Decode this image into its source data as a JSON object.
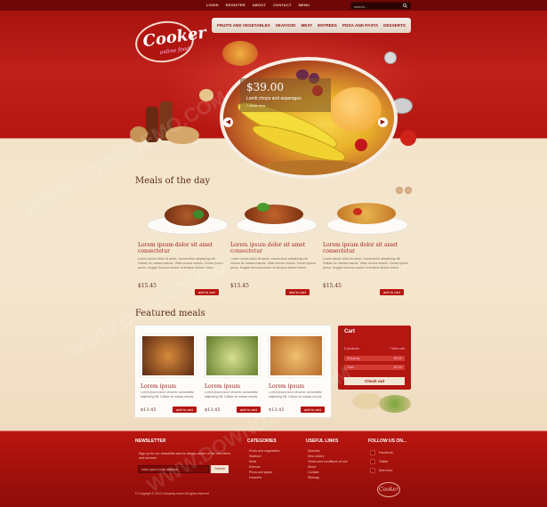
{
  "topbar": {
    "links": [
      "LOGIN",
      "REGISTER",
      "ABOUT",
      "CONTACT",
      "MENU"
    ],
    "search_placeholder": "search..."
  },
  "logo": {
    "name": "Cooker",
    "tagline": "online food"
  },
  "nav": {
    "items": [
      "FRUITS AND VEGETABLES",
      "SEAFOOD",
      "MEAT",
      "ENTREES",
      "PIZZA AND PASTA",
      "DESSERTS"
    ]
  },
  "hero": {
    "price": "$39.00",
    "description": "Lamb chops and asparagus",
    "link": "+ show now"
  },
  "meals_of_day": {
    "title": "Meals of the day",
    "items": [
      {
        "title": "Lorem ipsum dolor sit amet consectetur",
        "desc": "Lorem ipsum dolor sit amet, consectetur adipiscing elit. Nullam ac massa mauris. Vitae viverra mauris. Donec ipsum purus, feugiat rhoncus auctor ut tempus dictum lorem.",
        "price": "$15.45",
        "button": "add to cart"
      },
      {
        "title": "Lorem ipsum dolor sit amet consectetur",
        "desc": "Lorem ipsum dolor sit amet, consectetur adipiscing elit. Nullam ac massa mauris. Vitae viverra mauris. Donec ipsum purus, feugiat rhoncus auctor ut tempus dictum lorem.",
        "price": "$15.45",
        "button": "add to cart"
      },
      {
        "title": "Lorem ipsum dolor sit amet consectetur",
        "desc": "Lorem ipsum dolor sit amet, consectetur adipiscing elit. Nullam ac massa mauris. Vitae viverra mauris. Donec ipsum purus, feugiat rhoncus auctor ut tempus dictum lorem.",
        "price": "$15.45",
        "button": "add to cart"
      }
    ]
  },
  "featured": {
    "title": "Featured meals",
    "items": [
      {
        "title": "Lorem ipsum",
        "desc": "Lorem ipsum dolor sit amet, consectetur adipiscing elit. Nullam ac massa mauris.",
        "price": "$13.45",
        "button": "add to cart"
      },
      {
        "title": "Lorem ipsum",
        "desc": "Lorem ipsum dolor sit amet, consectetur adipiscing elit. Nullam ac massa mauris.",
        "price": "$13.45",
        "button": "add to cart"
      },
      {
        "title": "Lorem ipsum",
        "desc": "Lorem ipsum dolor sit amet, consectetur adipiscing elit. Nullam ac massa mauris.",
        "price": "$13.45",
        "button": "add to cart"
      }
    ]
  },
  "cart": {
    "title": "Cart",
    "products_label": "0 products",
    "view_cart": "+ View cart",
    "shipping_label": "Shipping",
    "shipping_value": "$0.00",
    "total_label": "Total",
    "total_value": "$0.00",
    "checkout": "Check out"
  },
  "footer": {
    "newsletter": {
      "title": "NEWSLETTER",
      "text": "Sign up for our newsletter and be always aware of the new offers and services",
      "placeholder": "enter your e-mail address",
      "submit": "Submit"
    },
    "categories": {
      "title": "CATEGORIES",
      "items": [
        "Fruits and vegetables",
        "Seafood",
        "Meat",
        "Entrees",
        "Pizza and pasta",
        "Desserts"
      ]
    },
    "useful_links": {
      "title": "USEFUL LINKS",
      "items": [
        "Specials",
        "New orders",
        "Terms and conditions of use",
        "About",
        "Contact",
        "Sitemap"
      ]
    },
    "follow": {
      "title": "FOLLOW US ON...",
      "items": [
        "Facebook",
        "Twitter",
        "Web feed"
      ]
    },
    "copyright": "© Copyright © 2013 Company name All rights reserved",
    "logo": "Cooker"
  },
  "watermark": "WWW.DOWNDEMO.COM",
  "colors": {
    "brand_red": "#b51611",
    "cream": "#f5e7cf",
    "dark_red": "#8f0c09"
  }
}
